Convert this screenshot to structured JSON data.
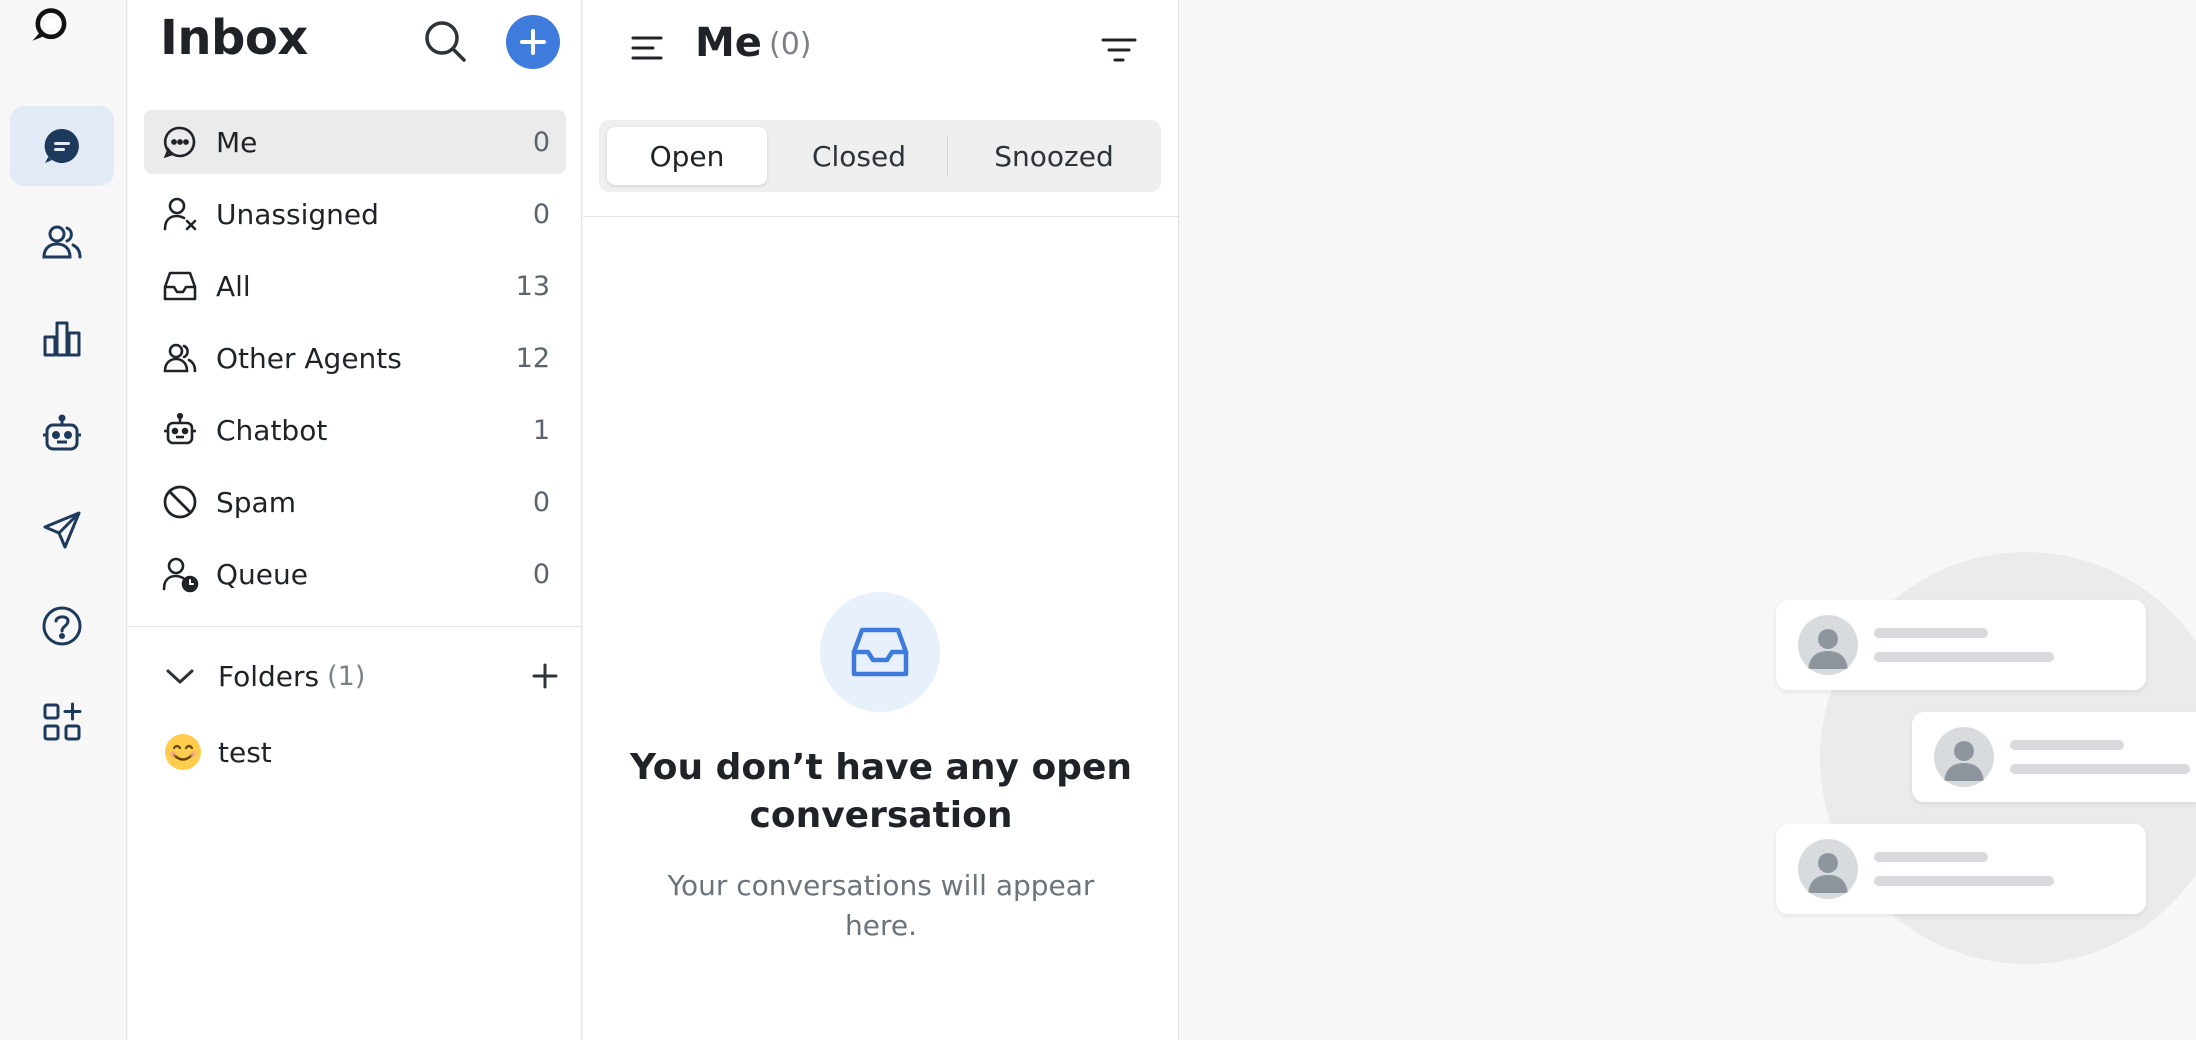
{
  "rail": {
    "items": [
      {
        "name": "conversations",
        "icon": "chat-bubble-icon",
        "active": true
      },
      {
        "name": "contacts",
        "icon": "users-icon",
        "active": false
      },
      {
        "name": "reports",
        "icon": "bar-chart-icon",
        "active": false
      },
      {
        "name": "bots",
        "icon": "robot-icon",
        "active": false
      },
      {
        "name": "campaigns",
        "icon": "send-icon",
        "active": false
      },
      {
        "name": "help",
        "icon": "help-icon",
        "active": false
      },
      {
        "name": "apps",
        "icon": "apps-icon",
        "active": false
      }
    ]
  },
  "inbox": {
    "title": "Inbox",
    "views": [
      {
        "label": "Me",
        "count": "0",
        "icon": "chat-dots-icon",
        "active": true
      },
      {
        "label": "Unassigned",
        "count": "0",
        "icon": "user-x-icon",
        "active": false
      },
      {
        "label": "All",
        "count": "13",
        "icon": "inbox-tray-icon",
        "active": false
      },
      {
        "label": "Other Agents",
        "count": "12",
        "icon": "users-icon",
        "active": false
      },
      {
        "label": "Chatbot",
        "count": "1",
        "icon": "robot-icon",
        "active": false
      },
      {
        "label": "Spam",
        "count": "0",
        "icon": "ban-icon",
        "active": false
      },
      {
        "label": "Queue",
        "count": "0",
        "icon": "user-clock-icon",
        "active": false
      }
    ],
    "folders": {
      "label": "Folders",
      "count": "(1)",
      "items": [
        {
          "emoji": "😊",
          "name": "test"
        }
      ]
    }
  },
  "conversations": {
    "title": "Me",
    "count": "(0)",
    "tabs": [
      {
        "label": "Open",
        "active": true
      },
      {
        "label": "Closed",
        "active": false
      },
      {
        "label": "Snoozed",
        "active": false
      }
    ],
    "empty": {
      "title": "You don’t have any open conversation",
      "subtitle": "Your conversations will appear here."
    }
  },
  "colors": {
    "accent": "#3e7bdc",
    "rail_icon": "#1d3a5c",
    "active_rail_bg": "#e2eaf5"
  }
}
